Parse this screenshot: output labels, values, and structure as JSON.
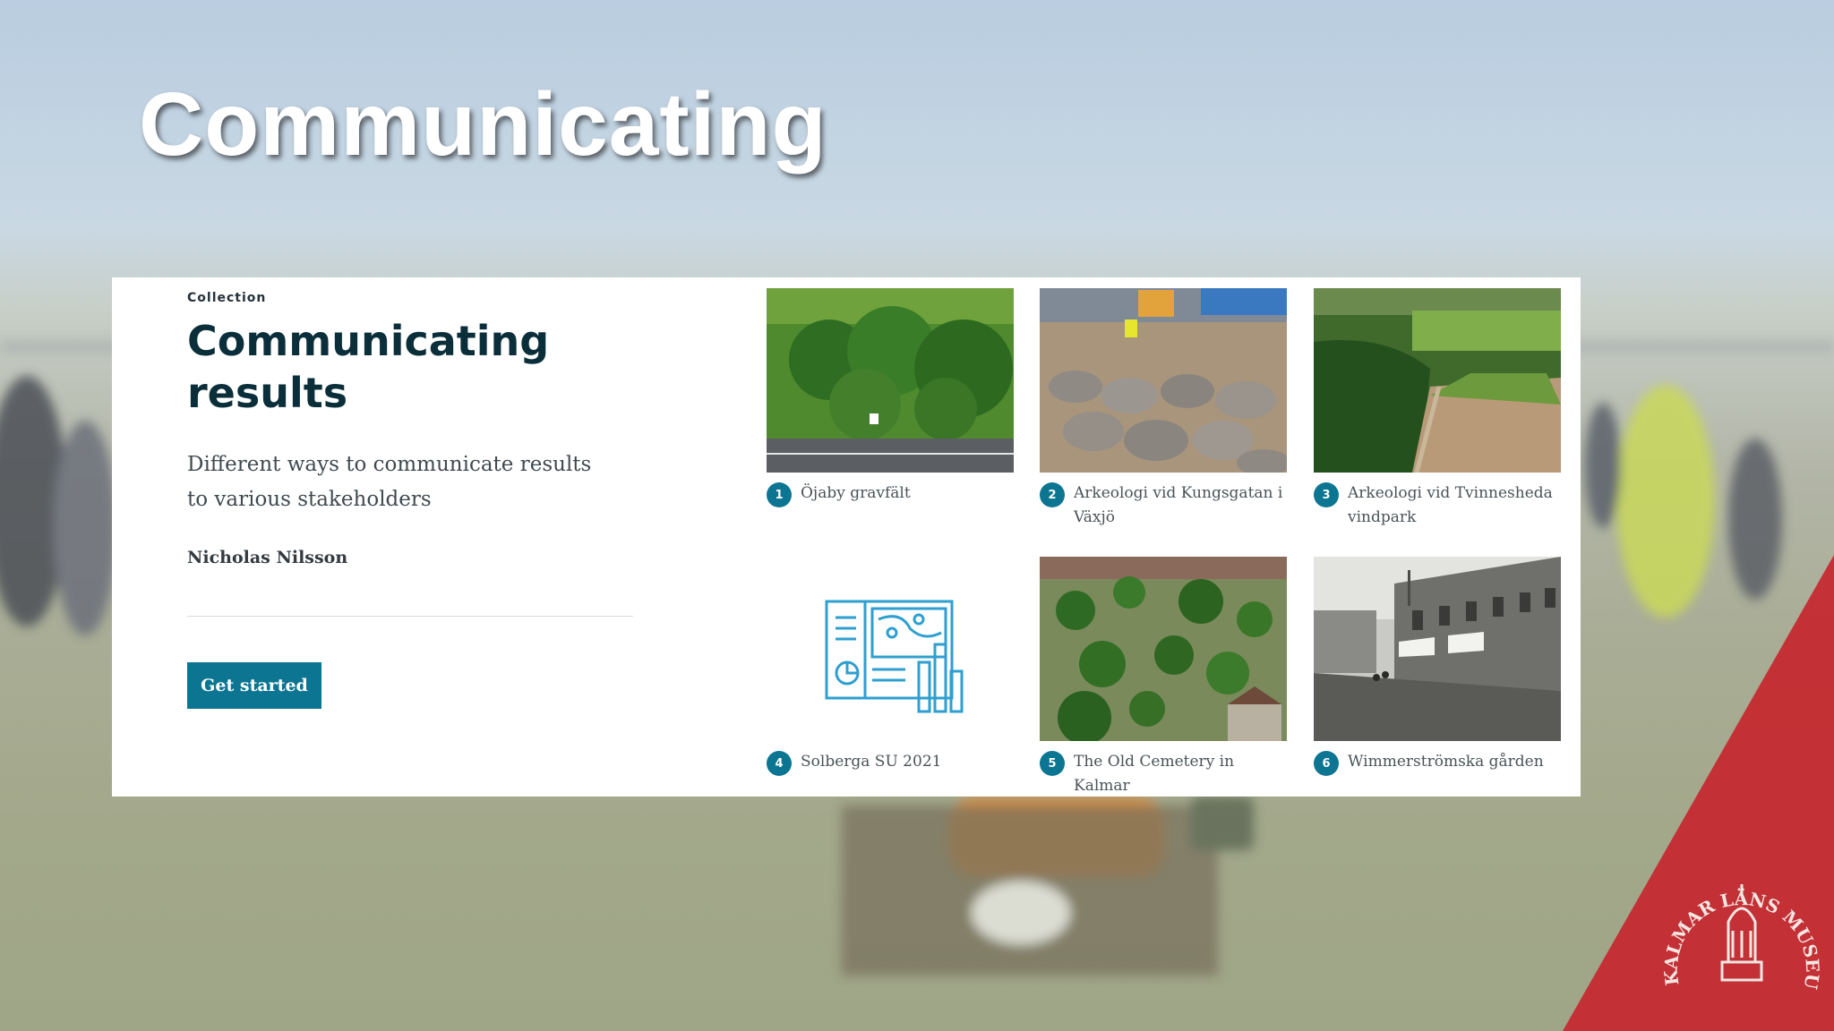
{
  "slide": {
    "title": "Communicating"
  },
  "collection": {
    "eyebrow": "Collection",
    "title": "Communicating results",
    "description": "Different ways to communicate results to various stakeholders",
    "author": "Nicholas Nilsson",
    "cta_label": "Get started"
  },
  "items": [
    {
      "number": "1",
      "title": "Öjaby gravfält",
      "image": "aerial-forest-road-photo"
    },
    {
      "number": "2",
      "title": "Arkeologi vid Kungsgatan i Växjö",
      "image": "cobblestone-excavation-photo"
    },
    {
      "number": "3",
      "title": "Arkeologi vid Tvinnesheda vindpark",
      "image": "forest-clearing-aerial-photo"
    },
    {
      "number": "4",
      "title": "Solberga SU 2021",
      "image": "map-chart-icon"
    },
    {
      "number": "5",
      "title": "The Old Cemetery in Kalmar",
      "image": "cemetery-aerial-photo"
    },
    {
      "number": "6",
      "title": "Wimmerströmska gården",
      "image": "historic-street-photo"
    }
  ],
  "logo": {
    "text": "KALMAR LÄNS MUSEUM",
    "color": "#c6262e"
  },
  "colors": {
    "accent": "#0c7592",
    "heading": "#0b2f3a"
  }
}
